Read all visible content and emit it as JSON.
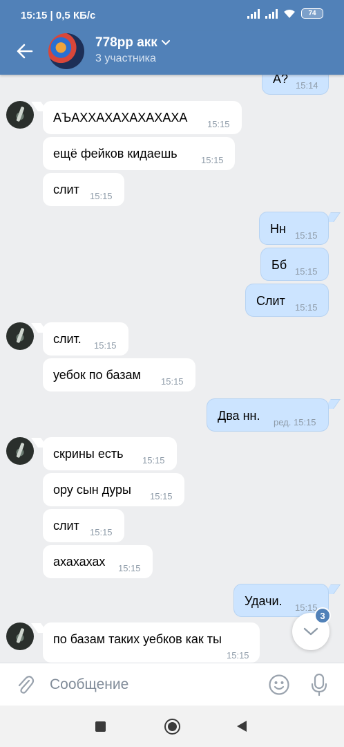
{
  "status": {
    "time": "15:15",
    "speed": "0,5 КБ/с",
    "battery": "74"
  },
  "header": {
    "title": "778рр акк",
    "subtitle": "3 участника"
  },
  "messages": [
    {
      "text": "А?",
      "time": "15:14"
    },
    {
      "text": "АЪАХХАХАХАХАХАХА",
      "time": "15:15"
    },
    {
      "text": "ещё фейков кидаешь",
      "time": "15:15"
    },
    {
      "text": "слит",
      "time": "15:15"
    },
    {
      "text": "Нн",
      "time": "15:15"
    },
    {
      "text": "Бб",
      "time": "15:15"
    },
    {
      "text": "Слит",
      "time": "15:15"
    },
    {
      "text": "слит.",
      "time": "15:15"
    },
    {
      "text": "уебок по базам",
      "time": "15:15"
    },
    {
      "text": "Два нн.",
      "time": "ред. 15:15"
    },
    {
      "text": "скрины есть",
      "time": "15:15"
    },
    {
      "text": "ору сын дуры",
      "time": "15:15"
    },
    {
      "text": "слит",
      "time": "15:15"
    },
    {
      "text": "ахахахах",
      "time": "15:15"
    },
    {
      "text": "Удачи.",
      "time": "15:15"
    },
    {
      "text": "по базам таких уебков как ты",
      "time": "15:15"
    }
  ],
  "scroll_down": {
    "unread_count": "3"
  },
  "composer": {
    "placeholder": "Сообщение"
  },
  "colors": {
    "accent": "#5181b8",
    "outgoing_bubble": "#cce4ff",
    "incoming_bubble": "#ffffff",
    "background": "#edeef0"
  },
  "icons": [
    "back-arrow-icon",
    "chevron-down-icon",
    "attach-icon",
    "emoji-icon",
    "mic-icon",
    "scroll-down-icon"
  ]
}
